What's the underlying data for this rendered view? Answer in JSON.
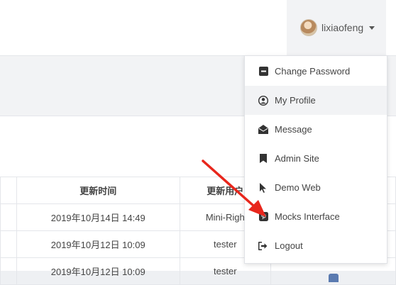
{
  "header": {
    "username": "lixiaofeng"
  },
  "table": {
    "headers": [
      "",
      "更新时间",
      "更新用户"
    ],
    "rows": [
      {
        "time": "2019年10月14日 14:49",
        "user": "Mini-Righ"
      },
      {
        "time": "2019年10月12日 10:09",
        "user": "tester"
      },
      {
        "time": "2019年10月12日 10:09",
        "user": "tester"
      }
    ]
  },
  "dropdown": {
    "items": [
      {
        "label": "Change Password",
        "icon": "minus-box-icon"
      },
      {
        "label": "My Profile",
        "icon": "user-circle-icon"
      },
      {
        "label": "Message",
        "icon": "envelope-open-icon"
      },
      {
        "label": "Admin Site",
        "icon": "bookmark-icon"
      },
      {
        "label": "Demo Web",
        "icon": "cursor-icon"
      },
      {
        "label": "Mocks Interface",
        "icon": "pinterest-icon"
      },
      {
        "label": "Logout",
        "icon": "sign-out-icon"
      }
    ]
  },
  "colors": {
    "annotation_arrow": "#e8261c",
    "background": "#eef0f3"
  }
}
